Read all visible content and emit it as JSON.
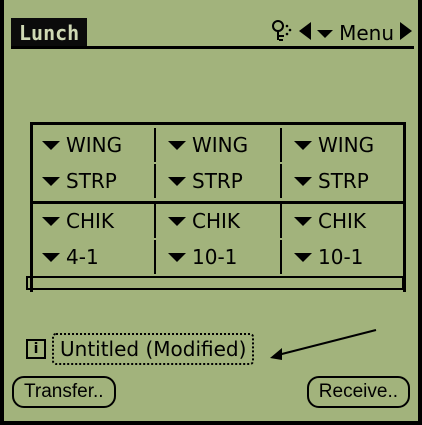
{
  "header": {
    "title": "Lunch",
    "menu_label": "Menu"
  },
  "icons": {
    "key": "key-icon",
    "left": "left-triangle-icon",
    "down": "down-triangle-icon",
    "right": "right-triangle-icon"
  },
  "grid": {
    "rows": [
      [
        "WING",
        "WING",
        "WING"
      ],
      [
        "STRP",
        "STRP",
        "STRP"
      ],
      [
        "CHIK",
        "CHIK",
        "CHIK"
      ],
      [
        "4-1",
        "10-1",
        "10-1"
      ]
    ]
  },
  "file": {
    "name": "Untitled (Modified)"
  },
  "buttons": {
    "transfer": "Transfer..",
    "receive": "Receive.."
  }
}
